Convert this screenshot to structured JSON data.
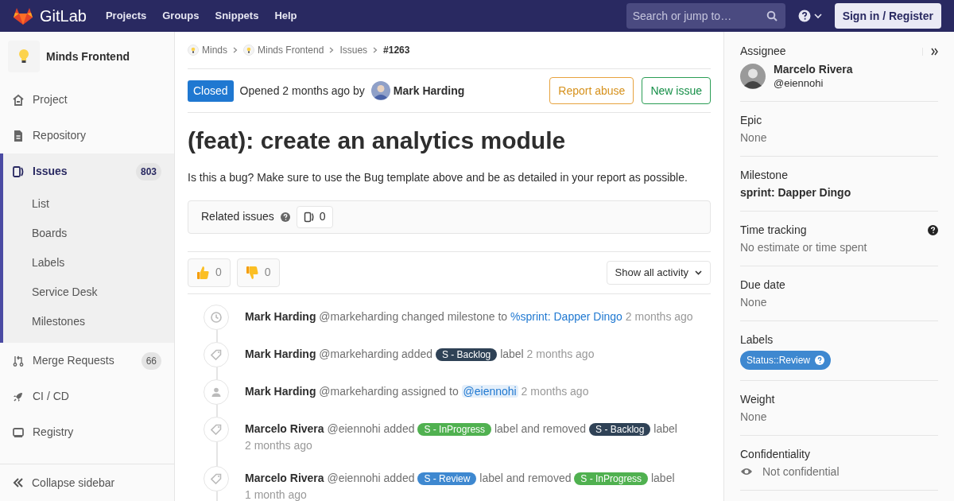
{
  "header": {
    "logo": "GitLab",
    "nav": [
      "Projects",
      "Groups",
      "Snippets",
      "Help"
    ],
    "search": {
      "placeholder": "Search or jump to…"
    },
    "sign_in": "Sign in / Register"
  },
  "sidebar": {
    "project": "Minds Frontend",
    "items": [
      {
        "label": "Project",
        "kind": "home",
        "selected": false
      },
      {
        "label": "Repository",
        "kind": "doc",
        "selected": false
      },
      {
        "label": "Issues",
        "kind": "issues",
        "count": "803",
        "selected": true,
        "children": [
          {
            "label": "List"
          },
          {
            "label": "Boards"
          },
          {
            "label": "Labels"
          },
          {
            "label": "Service Desk"
          },
          {
            "label": "Milestones"
          }
        ]
      },
      {
        "label": "Merge Requests",
        "kind": "merge",
        "count": "66",
        "selected": false
      },
      {
        "label": "CI / CD",
        "kind": "rocket",
        "selected": false
      },
      {
        "label": "Registry",
        "kind": "registry",
        "selected": false
      }
    ],
    "collapse": "Collapse sidebar"
  },
  "breadcrumbs": [
    {
      "label": "Minds",
      "kind": "group"
    },
    {
      "label": "Minds Frontend",
      "kind": "group"
    },
    {
      "label": "Issues",
      "kind": "plain"
    },
    {
      "label": "#1263",
      "kind": "current"
    }
  ],
  "issue": {
    "status": "Closed",
    "opened": "Opened 2 months ago by",
    "author": "Mark Harding",
    "buttons": [
      {
        "label": "Report abuse",
        "kind": "warning"
      },
      {
        "label": "New issue",
        "kind": "success"
      }
    ],
    "title": "(feat): create an analytics module",
    "description": "Is this a bug? Make sure to use the Bug template above and be as detailed in your report as possible.",
    "related": {
      "label": "Related issues",
      "count": "0"
    },
    "reactions": [
      {
        "kind": "thumbsup",
        "count": "0"
      },
      {
        "kind": "thumbsdown",
        "count": "0"
      }
    ],
    "activity_filter": "Show all activity"
  },
  "activity": [
    {
      "kind": "clock",
      "author": "Mark Harding",
      "handle": "@markeharding",
      "parts": [
        {
          "kind": "text",
          "text": "changed milestone to"
        },
        {
          "kind": "link",
          "text": "%sprint: Dapper Dingo"
        }
      ],
      "time": "2 months ago"
    },
    {
      "kind": "tag",
      "author": "Mark Harding",
      "handle": "@markeharding",
      "parts": [
        {
          "kind": "text",
          "text": "added"
        },
        {
          "kind": "label",
          "text": "S - Backlog",
          "color": "#2f4256"
        },
        {
          "kind": "text",
          "text": "label"
        }
      ],
      "time": "2 months ago"
    },
    {
      "kind": "person",
      "author": "Mark Harding",
      "handle": "@markeharding",
      "parts": [
        {
          "kind": "text",
          "text": "assigned to"
        },
        {
          "kind": "mention",
          "text": "@eiennohi"
        }
      ],
      "time": "2 months ago"
    },
    {
      "kind": "tag",
      "author": "Marcelo Rivera",
      "handle": "@eiennohi",
      "parts": [
        {
          "kind": "text",
          "text": "added"
        },
        {
          "kind": "label",
          "text": "S - InProgress",
          "color": "#50b150"
        },
        {
          "kind": "text",
          "text": "label and removed"
        },
        {
          "kind": "label",
          "text": "S - Backlog",
          "color": "#2f4256"
        },
        {
          "kind": "text",
          "text": "label"
        }
      ],
      "time": "2 months ago"
    },
    {
      "kind": "tag",
      "author": "Marcelo Rivera",
      "handle": "@eiennohi",
      "parts": [
        {
          "kind": "text",
          "text": "added"
        },
        {
          "kind": "label",
          "text": "S - Review",
          "color": "#3e88d0"
        },
        {
          "kind": "text",
          "text": "label and removed"
        },
        {
          "kind": "label",
          "text": "S - InProgress",
          "color": "#50b150"
        },
        {
          "kind": "text",
          "text": "label"
        }
      ],
      "time": "1 month ago"
    }
  ],
  "right_sidebar": {
    "assignee": {
      "title": "Assignee",
      "name": "Marcelo Rivera",
      "handle": "@eiennohi"
    },
    "sections": [
      {
        "title": "Epic",
        "kind": "muted",
        "value": "None"
      },
      {
        "title": "Milestone",
        "kind": "bold",
        "value": "sprint: Dapper Dingo"
      },
      {
        "title": "Time tracking",
        "kind": "help",
        "value": "No estimate or time spent"
      },
      {
        "title": "Due date",
        "kind": "muted",
        "value": "None"
      },
      {
        "title": "Labels",
        "kind": "label",
        "value": "Status::Review",
        "color": "#3e88d0"
      },
      {
        "title": "Weight",
        "kind": "muted",
        "value": "None"
      },
      {
        "title": "Confidentiality",
        "kind": "eye",
        "value": "Not confidential"
      }
    ]
  }
}
